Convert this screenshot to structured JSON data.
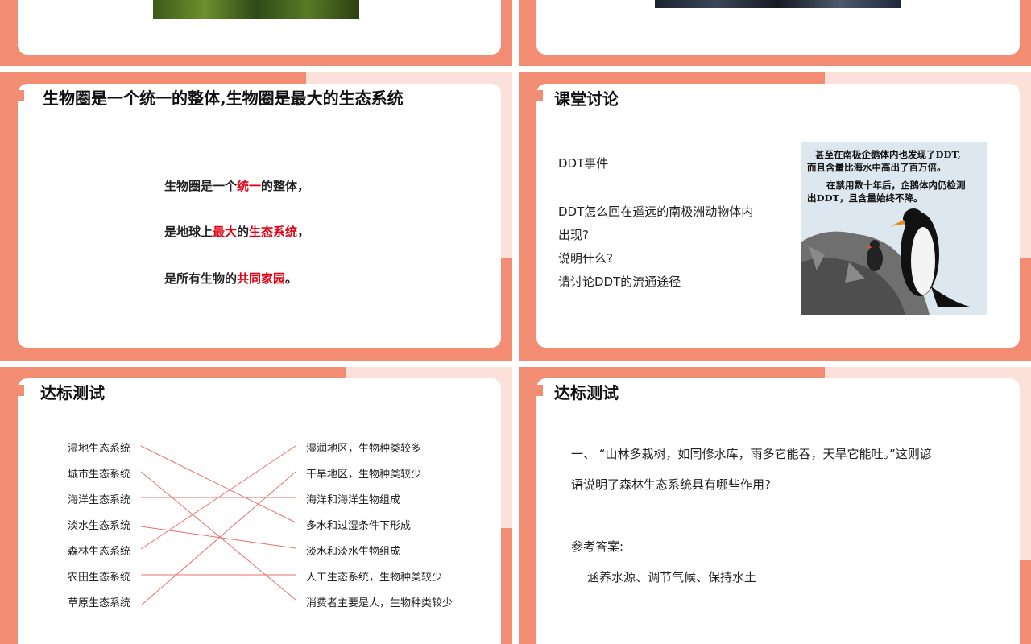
{
  "slide3": {
    "title": "生物圈是一个统一的整体,生物圈是最大的生态系统",
    "line1": [
      "生物圈是一个",
      "统一",
      "的整体，"
    ],
    "line2": [
      "是地球上",
      "最大",
      "的",
      "生态系统",
      "，"
    ],
    "line3": [
      "是所有生物的",
      "共同家园",
      "。"
    ]
  },
  "slide4": {
    "title": "课堂讨论",
    "event": "DDT事件",
    "q1": "DDT怎么回在遥远的南极洲动物体内",
    "q1b": "出现?",
    "q2": "说明什么?",
    "q3": "请讨论DDT的流通途径",
    "image_text1": "甚至在南极企鹅体内也发现了DDT,",
    "image_text2": "而且含量比海水中高出了百万倍。",
    "image_text3": "在禁用数十年后，企鹅体内仍检测",
    "image_text4": "出DDT，且含量始终不降。"
  },
  "slide5": {
    "title": "达标测试",
    "left": [
      "湿地生态系统",
      "城市生态系统",
      "海洋生态系统",
      "淡水生态系统",
      "森林生态系统",
      "农田生态系统",
      "草原生态系统"
    ],
    "right": [
      "湿润地区，生物种类较多",
      "干旱地区，生物种类较少",
      "海洋和海洋生物组成",
      "多水和过湿条件下形成",
      "淡水和淡水生物组成",
      "人工生态系统，生物种类较少",
      "消费者主要是人，生物种类较少"
    ]
  },
  "slide6": {
    "title": "达标测试",
    "q_line1": "一、 “山林多栽树，如同修水库，雨多它能吞，天旱它能吐。”这则谚",
    "q_line2": "语说明了森林生态系统具有哪些作用?",
    "answer_label": "参考答案:",
    "answer": "涵养水源、调节气候、保持水土"
  },
  "colors": {
    "accent": "#f28d74",
    "light": "#fbe1d9",
    "red": "#e60012"
  }
}
